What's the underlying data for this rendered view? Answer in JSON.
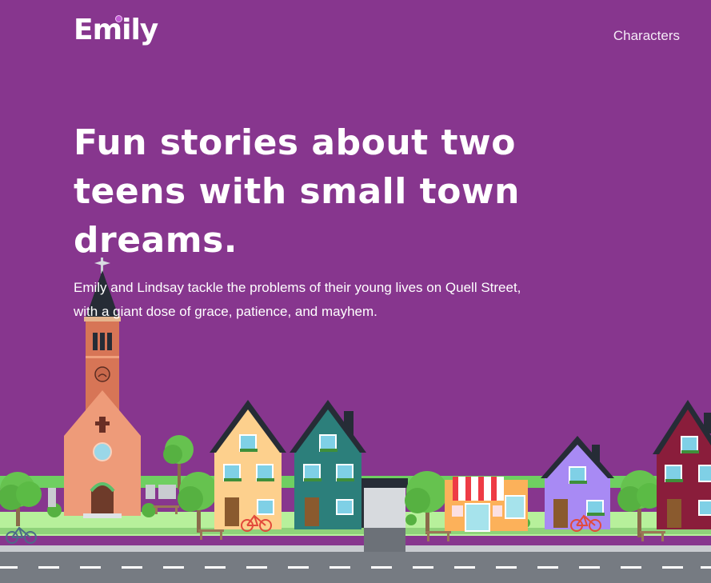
{
  "header": {
    "logo": "Emily",
    "nav_characters": "Characters"
  },
  "hero": {
    "headline": "Fun stories about two teens with small town dreams.",
    "intro": "Emily and Lindsay tackle the problems of their young lives on Quell Street, with a giant dose of grace, patience, and mayhem."
  },
  "colors": {
    "background": "#87368e",
    "road": "#767b82",
    "grass": "#b7f09b"
  }
}
